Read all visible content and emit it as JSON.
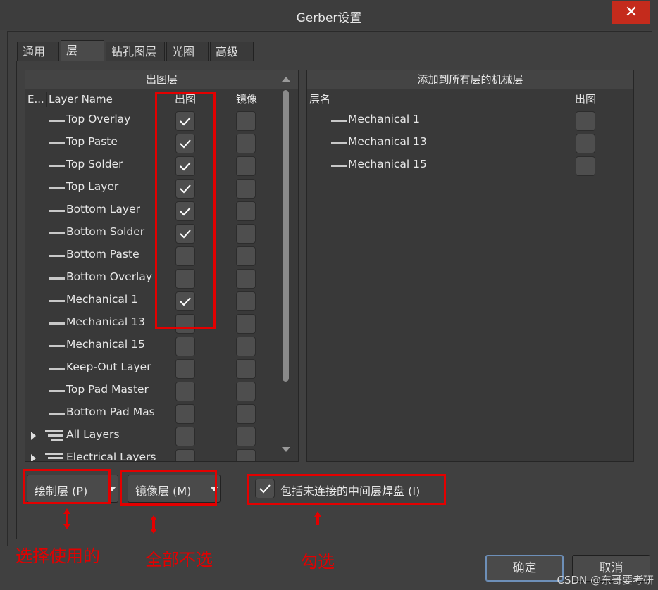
{
  "window": {
    "title": "Gerber设置",
    "close_label": "✕"
  },
  "tabs": [
    {
      "label": "通用"
    },
    {
      "label": "层",
      "active": true
    },
    {
      "label": "钻孔图层"
    },
    {
      "label": "光圈"
    },
    {
      "label": "高级"
    }
  ],
  "left_panel": {
    "section_title": "出图层",
    "columns": {
      "expand": "E...",
      "layer_name": "Layer Name",
      "plot": "出图",
      "mirror": "镜像"
    },
    "layers": [
      {
        "name": "Top Overlay",
        "plot": true,
        "mirror": false
      },
      {
        "name": "Top Paste",
        "plot": true,
        "mirror": false
      },
      {
        "name": "Top Solder",
        "plot": true,
        "mirror": false
      },
      {
        "name": "Top Layer",
        "plot": true,
        "mirror": false
      },
      {
        "name": "Bottom Layer",
        "plot": true,
        "mirror": false
      },
      {
        "name": "Bottom Solder",
        "plot": true,
        "mirror": false
      },
      {
        "name": "Bottom Paste",
        "plot": false,
        "mirror": false
      },
      {
        "name": "Bottom Overlay",
        "plot": false,
        "mirror": false
      },
      {
        "name": "Mechanical 1",
        "plot": true,
        "mirror": false
      },
      {
        "name": "Mechanical 13",
        "plot": false,
        "mirror": false
      },
      {
        "name": "Mechanical 15",
        "plot": false,
        "mirror": false
      },
      {
        "name": "Keep-Out Layer",
        "plot": false,
        "mirror": false
      },
      {
        "name": "Top Pad Master",
        "plot": false,
        "mirror": false
      },
      {
        "name": "Bottom Pad Mas",
        "plot": false,
        "mirror": false
      }
    ],
    "groups": [
      {
        "name": "All Layers",
        "plot": false,
        "mirror": false
      },
      {
        "name": "Electrical Layers",
        "plot": false,
        "mirror": false
      }
    ]
  },
  "right_panel": {
    "section_title": "添加到所有层的机械层",
    "columns": {
      "layer_name": "层名",
      "plot": "出图"
    },
    "layers": [
      {
        "name": "Mechanical 1",
        "plot": false
      },
      {
        "name": "Mechanical 13",
        "plot": false
      },
      {
        "name": "Mechanical 15",
        "plot": false
      }
    ]
  },
  "controls": {
    "plot_layers_button": "绘制层 (P)",
    "mirror_layers_button": "镜像层 (M)",
    "include_unconnected_pads_label": "包括未连接的中间层焊盘 (I)",
    "include_unconnected_pads_checked": true
  },
  "annotations": {
    "choose_used": "选择使用的",
    "deselect_all": "全部不选",
    "check": "勾选"
  },
  "footer": {
    "ok_label": "确定",
    "cancel_label": "取消"
  },
  "watermark": "CSDN @东哥要考研",
  "colors": {
    "annotation_red": "#e30000",
    "close_red": "#c42b1c",
    "background": "#404040"
  }
}
